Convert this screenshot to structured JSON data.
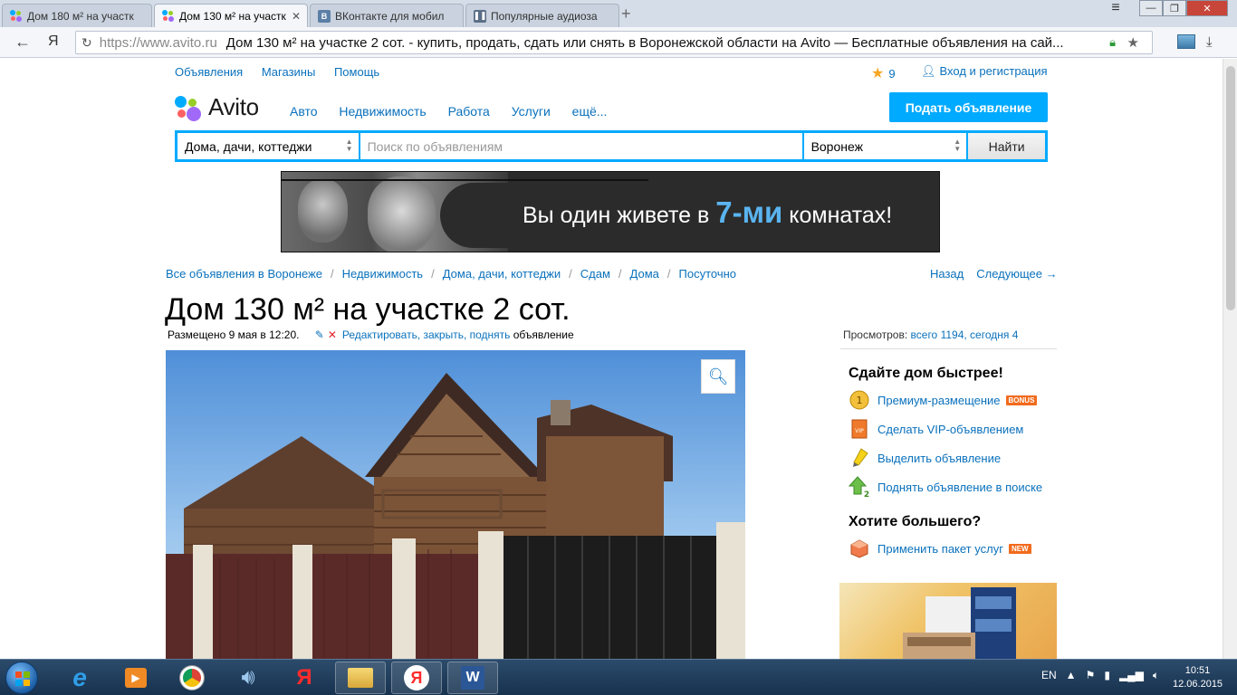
{
  "browser": {
    "tabs": [
      {
        "label": "Дом 180 м² на участк",
        "icon": "avito-favicon",
        "active": false
      },
      {
        "label": "Дом 130 м² на участк",
        "icon": "avito-favicon",
        "active": true
      },
      {
        "label": "ВКонтакте для мобил",
        "icon": "vk-favicon",
        "active": false
      },
      {
        "label": "Популярные аудиоза",
        "icon": "pause-favicon",
        "active": false
      }
    ],
    "tab_close": "✕",
    "new_tab": "+",
    "window_controls": {
      "minimize": "—",
      "maximize": "❐",
      "close": "✕"
    },
    "menu_icon": "≡",
    "yandex_button": "Я",
    "url": "https://www.avito.ru",
    "page_title": "Дом 130 м² на участке 2 сот. - купить, продать, сдать или снять в Воронежской области на Avito — Бесплатные объявления на сай..."
  },
  "site": {
    "topnav": [
      "Объявления",
      "Магазины",
      "Помощь"
    ],
    "favorites_count": "9",
    "login": "Вход и регистрация",
    "logo": "Avito",
    "logo_colors": [
      "#00aaff",
      "#97cf26",
      "#ff6163",
      "#a169f7"
    ],
    "categories": [
      "Авто",
      "Недвижимость",
      "Работа",
      "Услуги",
      "ещё..."
    ],
    "post_button": "Подать объявление",
    "search": {
      "category": "Дома, дачи, коттеджи",
      "placeholder": "Поиск по объявлениям",
      "city": "Воронеж",
      "button": "Найти"
    },
    "banner": {
      "text_before": "Вы один живете в ",
      "highlight": "7-ми",
      "text_after": " комнатах!"
    },
    "breadcrumbs": [
      "Все объявления в Воронеже",
      "Недвижимость",
      "Дома, дачи, коттеджи",
      "Сдам",
      "Дома",
      "Посуточно"
    ],
    "breadcrumb_separator": "/",
    "pager": {
      "back": "Назад",
      "next": "Следующее →"
    },
    "listing": {
      "title": "Дом 130 м² на участке 2 сот.",
      "posted": "Размещено 9 мая в 12:20.",
      "edit_actions": "Редактировать, закрыть, поднять",
      "edit_suffix": " объявление"
    },
    "views": {
      "label": "Просмотров: ",
      "value": "всего 1194, сегодня 4"
    },
    "sidebar": {
      "sell_faster_title": "Сдайте дом быстрее!",
      "services": [
        {
          "label": "Премиум-размещение",
          "badge": "BONUS",
          "icon": "premium-coin-icon"
        },
        {
          "label": "Сделать VIP-объявлением",
          "badge": "",
          "icon": "vip-icon"
        },
        {
          "label": "Выделить объявление",
          "badge": "",
          "icon": "highlighter-icon"
        },
        {
          "label": "Поднять объявление в поиске",
          "badge": "",
          "icon": "up-arrow-icon"
        }
      ],
      "want_more_title": "Хотите большего?",
      "package": {
        "label": "Применить пакет услуг",
        "badge": "NEW",
        "icon": "package-icon"
      }
    }
  },
  "taskbar": {
    "language": "EN",
    "time": "10:51",
    "date": "12.06.2015"
  }
}
